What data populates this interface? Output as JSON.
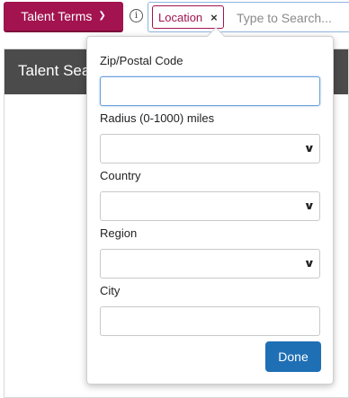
{
  "toolbar": {
    "talent_terms_label": "Talent Terms",
    "chevron_icon": "chevron-down-icon",
    "info_icon": "info-icon",
    "info_glyph": "i"
  },
  "search": {
    "tag_label": "Location",
    "tag_remove_glyph": "×",
    "placeholder": "Type to Search..."
  },
  "panel": {
    "header_title": "Talent Sea"
  },
  "location_form": {
    "zip_label": "Zip/Postal Code",
    "zip_value": "",
    "radius_label": "Radius (0-1000) miles",
    "radius_value": "",
    "country_label": "Country",
    "country_value": "",
    "region_label": "Region",
    "region_value": "",
    "city_label": "City",
    "city_value": "",
    "done_label": "Done"
  },
  "colors": {
    "brand": "#a3134f",
    "primary_button": "#1f6fb5",
    "panel_header": "#4b4b4b"
  }
}
